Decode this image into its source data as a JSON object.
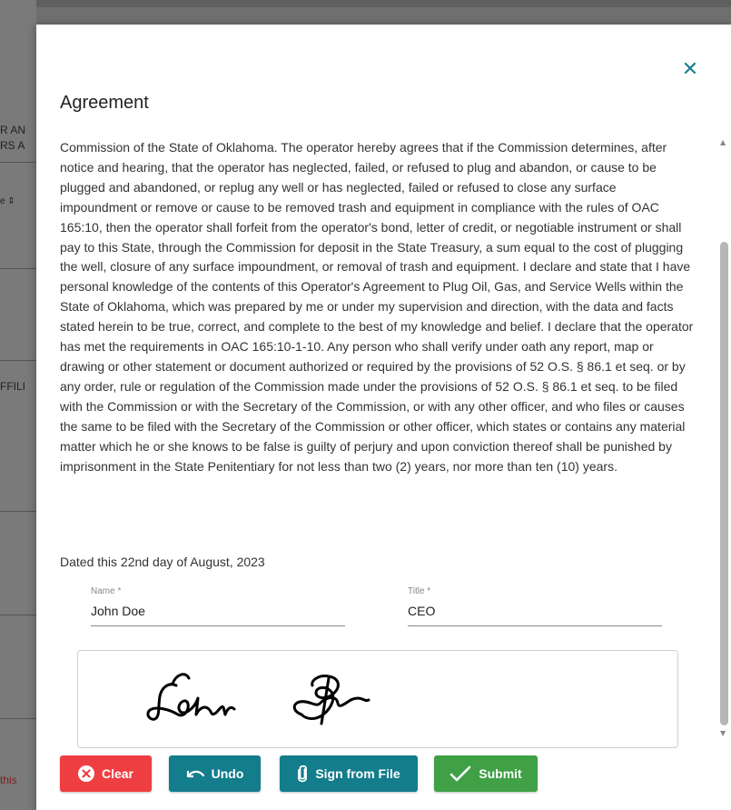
{
  "background": {
    "fragments": [
      "R AN",
      "RS A",
      "e ⇕",
      "FFILI",
      "this"
    ]
  },
  "dialog": {
    "title": "Agreement",
    "close_icon": "close-icon",
    "body": "Commission of the State of Oklahoma. The operator hereby agrees that if the Commission determines, after notice and hearing, that the operator has neglected, failed, or refused to plug and abandon, or cause to be plugged and abandoned, or replug any well or has neglected, failed or refused to close any surface impoundment or remove or cause to be removed trash and equipment in compliance with the rules of OAC 165:10, then the operator shall forfeit from the operator's bond, letter of credit, or negotiable instrument or shall pay to this State, through the Commission for deposit in the State Treasury, a sum equal to the cost of plugging the well, closure of any surface impoundment, or removal of trash and equipment. I declare and state that I have personal knowledge of the contents of this Operator's Agreement to Plug Oil, Gas, and Service Wells within the State of Oklahoma, which was prepared by me or under my supervision and direction, with the data and facts stated herein to be true, correct, and complete to the best of my knowledge and belief. I declare that the operator has met the requirements in OAC 165:10-1-10. Any person who shall verify under oath any report, map or drawing or other statement or document authorized or required by the provisions of 52 O.S. § 86.1 et seq. or by any order, rule or regulation of the Commission made under the provisions of 52 O.S. § 86.1 et seq. to be filed with the Commission or with the Secretary of the Commission, or with any other officer, and who files or causes the same to be filed with the Secretary of the Commission or other officer, which states or contains any material matter which he or she knows to be false is guilty of perjury and upon conviction thereof shall be punished by imprisonment in the State Penitentiary for not less than two (2) years, nor more than ten (10) years.",
    "dated": "Dated this 22nd day of August, 2023",
    "name_label": "Name *",
    "name_value": "John Doe",
    "title_label": "Title *",
    "title_value": "CEO",
    "signature": "John Doe"
  },
  "buttons": {
    "clear": "Clear",
    "undo": "Undo",
    "sign_from_file": "Sign from File",
    "submit": "Submit"
  },
  "colors": {
    "accent": "#1a7f8e",
    "clear": "#ef3e42",
    "undo": "#137d8c",
    "sign_from_file": "#137d8c",
    "submit": "#3fa046"
  }
}
